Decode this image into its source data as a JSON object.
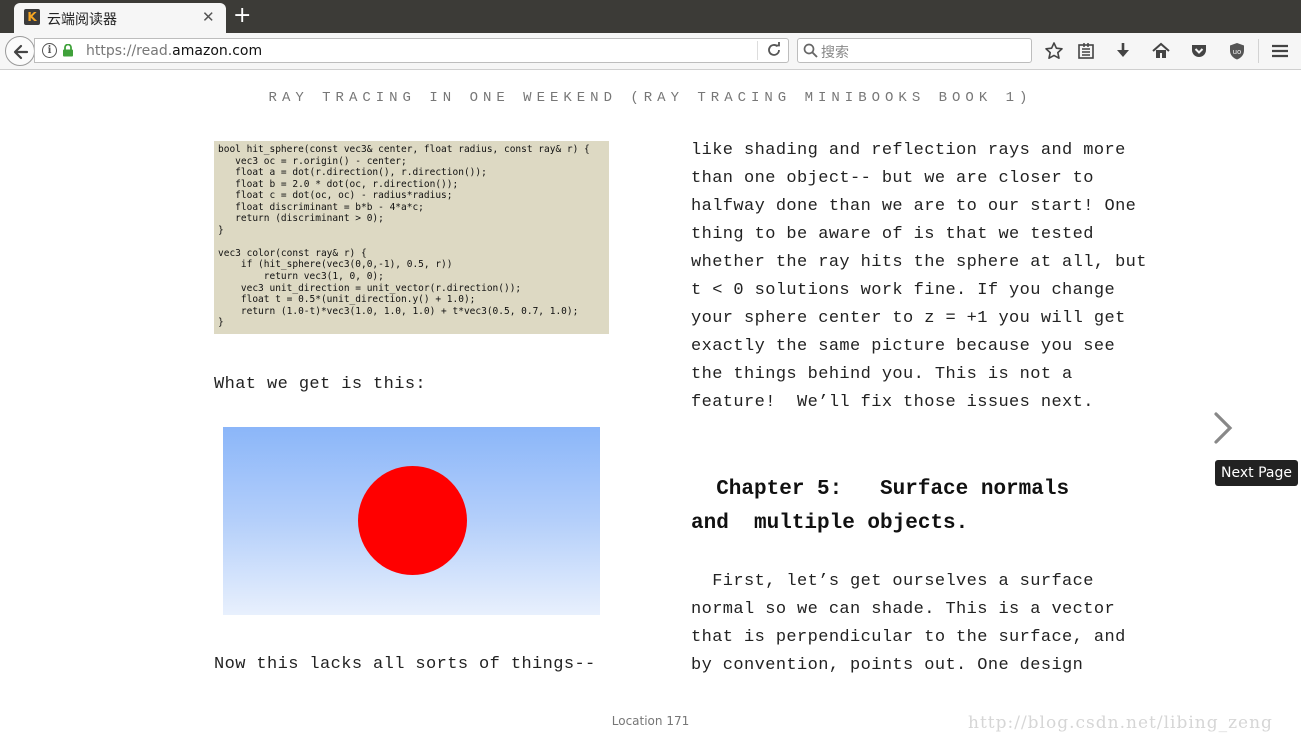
{
  "browser": {
    "tab_title": "云端阅读器",
    "tab_favicon_letter": "K",
    "tab_close": "✕",
    "new_tab": "+",
    "url_prefix": "https://read.",
    "url_domain": "amazon.com",
    "search_placeholder": "搜索",
    "toolbar_icons": [
      "bookmark-star-icon",
      "reading-list-icon",
      "download-icon",
      "home-icon",
      "pocket-icon",
      "ublock-icon",
      "menu-icon"
    ]
  },
  "reader": {
    "book_title": "RAY TRACING IN ONE WEEKEND (RAY TRACING MINIBOOKS BOOK 1)",
    "code_lines": [
      "bool hit_sphere(const vec3& center, float radius, const ray& r) {",
      "   vec3 oc = r.origin() - center;",
      "   float a = dot(r.direction(), r.direction());",
      "   float b = 2.0 * dot(oc, r.direction());",
      "   float c = dot(oc, oc) - radius*radius;",
      "   float discriminant = b*b - 4*a*c;",
      "   return (discriminant > 0);",
      "}",
      "",
      "vec3 color(const ray& r) {",
      "    if (hit_sphere(vec3(0,0,-1), 0.5, r))",
      "        return vec3(1, 0, 0);",
      "    vec3 unit_direction = unit_vector(r.direction());",
      "    float t = 0.5*(unit_direction.y() + 1.0);",
      "    return (1.0-t)*vec3(1.0, 1.0, 1.0) + t*vec3(0.5, 0.7, 1.0);",
      "}"
    ],
    "what_we_get": "What we get is this:",
    "now_this_lacks": "Now this lacks all sorts of things--",
    "right_lines": [
      "like shading and reflection rays and more",
      "than one object-- but we are closer to",
      "halfway done than we are to our start! One",
      "thing to be aware of is that we tested",
      "whether the ray hits the sphere at all, but",
      "t < 0 solutions work fine. If you change",
      "your sphere center to z = +1 you will get",
      "exactly the same picture because you see",
      "the things behind you. This is not a",
      "feature!  We’ll fix those issues next."
    ],
    "chapter_line1": "  Chapter 5:   Surface normals",
    "chapter_line2": "and  multiple objects.",
    "right_lines2": [
      "  First, let’s get ourselves a surface",
      "normal so we can shade. This is a vector",
      "that is perpendicular to the surface, and",
      "by convention, points out. One design"
    ],
    "next_page_tooltip": "Next Page",
    "location": "Location 171",
    "watermark": "http://blog.csdn.net/libing_zeng"
  }
}
